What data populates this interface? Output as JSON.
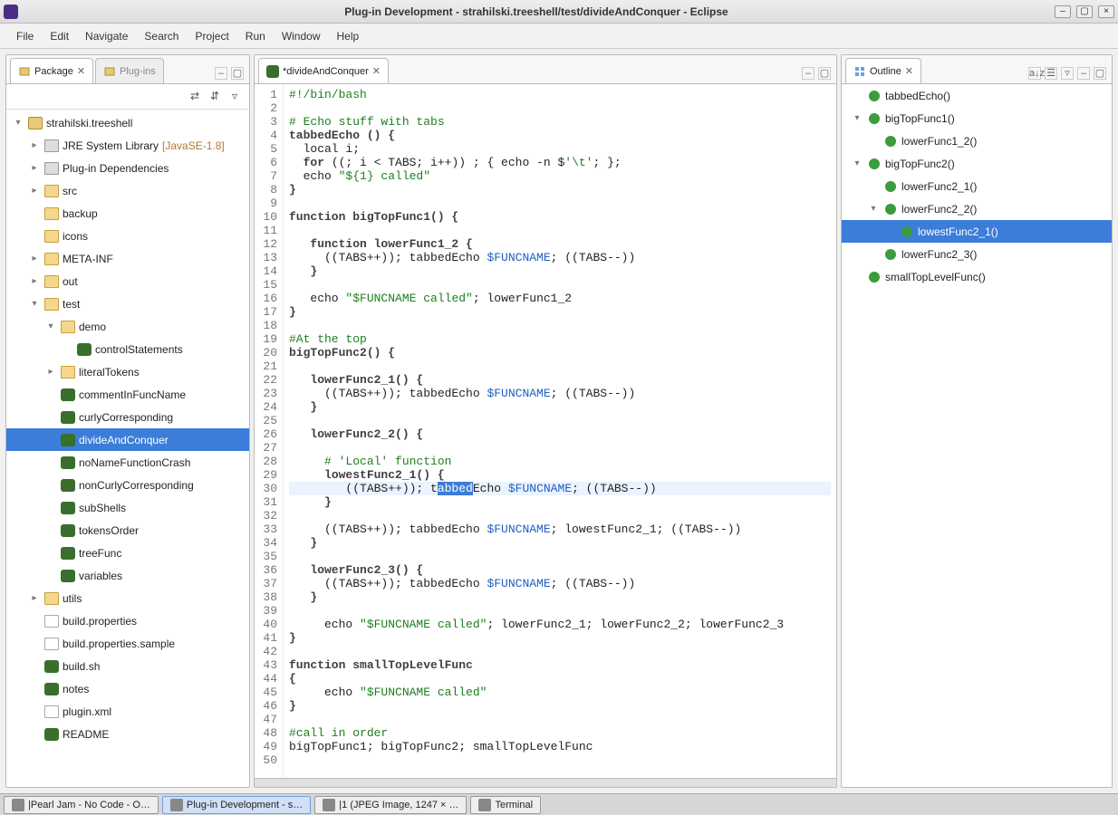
{
  "window": {
    "title": "Plug-in Development - strahilski.treeshell/test/divideAndConquer - Eclipse"
  },
  "menu": [
    "File",
    "Edit",
    "Navigate",
    "Search",
    "Project",
    "Run",
    "Window",
    "Help"
  ],
  "left": {
    "tabs": [
      {
        "label": "Package",
        "active": true,
        "close": true
      },
      {
        "label": "Plug-ins",
        "active": false,
        "close": false
      }
    ],
    "tree": [
      {
        "d": 0,
        "tw": "exp",
        "ic": "proj",
        "label": "strahilski.treeshell"
      },
      {
        "d": 1,
        "tw": "col",
        "ic": "lib",
        "label": "JRE System Library",
        "extra": " [JavaSE-1.8]"
      },
      {
        "d": 1,
        "tw": "col",
        "ic": "lib",
        "label": "Plug-in Dependencies"
      },
      {
        "d": 1,
        "tw": "col",
        "ic": "fold",
        "label": "src"
      },
      {
        "d": 1,
        "tw": "",
        "ic": "fold",
        "label": "backup"
      },
      {
        "d": 1,
        "tw": "",
        "ic": "fold",
        "label": "icons"
      },
      {
        "d": 1,
        "tw": "col",
        "ic": "fold",
        "label": "META-INF"
      },
      {
        "d": 1,
        "tw": "col",
        "ic": "fold",
        "label": "out"
      },
      {
        "d": 1,
        "tw": "exp",
        "ic": "fold",
        "label": "test"
      },
      {
        "d": 2,
        "tw": "exp",
        "ic": "fold",
        "label": "demo"
      },
      {
        "d": 3,
        "tw": "",
        "ic": "sh",
        "label": "controlStatements"
      },
      {
        "d": 2,
        "tw": "col",
        "ic": "fold",
        "label": "literalTokens"
      },
      {
        "d": 2,
        "tw": "",
        "ic": "sh",
        "label": "commentInFuncName"
      },
      {
        "d": 2,
        "tw": "",
        "ic": "sh",
        "label": "curlyCorresponding"
      },
      {
        "d": 2,
        "tw": "",
        "ic": "sh",
        "label": "divideAndConquer",
        "sel": true
      },
      {
        "d": 2,
        "tw": "",
        "ic": "sh",
        "label": "noNameFunctionCrash"
      },
      {
        "d": 2,
        "tw": "",
        "ic": "sh",
        "label": "nonCurlyCorresponding"
      },
      {
        "d": 2,
        "tw": "",
        "ic": "sh",
        "label": "subShells"
      },
      {
        "d": 2,
        "tw": "",
        "ic": "sh",
        "label": "tokensOrder"
      },
      {
        "d": 2,
        "tw": "",
        "ic": "sh",
        "label": "treeFunc"
      },
      {
        "d": 2,
        "tw": "",
        "ic": "sh",
        "label": "variables"
      },
      {
        "d": 1,
        "tw": "col",
        "ic": "fold",
        "label": "utils"
      },
      {
        "d": 1,
        "tw": "",
        "ic": "file",
        "label": "build.properties"
      },
      {
        "d": 1,
        "tw": "",
        "ic": "file",
        "label": "build.properties.sample"
      },
      {
        "d": 1,
        "tw": "",
        "ic": "sh",
        "label": "build.sh"
      },
      {
        "d": 1,
        "tw": "",
        "ic": "sh",
        "label": "notes"
      },
      {
        "d": 1,
        "tw": "",
        "ic": "file",
        "label": "plugin.xml"
      },
      {
        "d": 1,
        "tw": "",
        "ic": "sh",
        "label": "README"
      }
    ]
  },
  "editor": {
    "tabLabel": "*divideAndConquer",
    "lines": [
      {
        "n": 1,
        "segs": [
          {
            "t": "#!/bin/bash",
            "c": "cm"
          }
        ]
      },
      {
        "n": 2,
        "segs": []
      },
      {
        "n": 3,
        "segs": [
          {
            "t": "# Echo stuff with tabs",
            "c": "cm"
          }
        ]
      },
      {
        "n": 4,
        "segs": [
          {
            "t": "tabbedEcho () {",
            "c": "kw"
          }
        ]
      },
      {
        "n": 5,
        "segs": [
          {
            "t": "  local i;"
          }
        ]
      },
      {
        "n": 6,
        "segs": [
          {
            "t": "  "
          },
          {
            "t": "for",
            "c": "kw"
          },
          {
            "t": " ((; i < TABS; i++)) ; { echo -n $"
          },
          {
            "t": "'\\t'",
            "c": "str"
          },
          {
            "t": "; };"
          }
        ]
      },
      {
        "n": 7,
        "segs": [
          {
            "t": "  echo "
          },
          {
            "t": "\"${1} called\"",
            "c": "str"
          }
        ]
      },
      {
        "n": 8,
        "segs": [
          {
            "t": "}",
            "c": "kw"
          }
        ]
      },
      {
        "n": 9,
        "segs": []
      },
      {
        "n": 10,
        "segs": [
          {
            "t": "function bigTopFunc1() {",
            "c": "kw"
          }
        ]
      },
      {
        "n": 11,
        "segs": []
      },
      {
        "n": 12,
        "segs": [
          {
            "t": "   "
          },
          {
            "t": "function lowerFunc1_2 {",
            "c": "kw"
          }
        ]
      },
      {
        "n": 13,
        "segs": [
          {
            "t": "     ((TABS++)); tabbedEcho "
          },
          {
            "t": "$FUNCNAME",
            "c": "var"
          },
          {
            "t": "; ((TABS--))"
          }
        ]
      },
      {
        "n": 14,
        "segs": [
          {
            "t": "   "
          },
          {
            "t": "}",
            "c": "kw"
          }
        ]
      },
      {
        "n": 15,
        "segs": []
      },
      {
        "n": 16,
        "segs": [
          {
            "t": "   echo "
          },
          {
            "t": "\"$FUNCNAME called\"",
            "c": "str"
          },
          {
            "t": "; lowerFunc1_2"
          }
        ]
      },
      {
        "n": 17,
        "segs": [
          {
            "t": "}",
            "c": "kw"
          }
        ]
      },
      {
        "n": 18,
        "segs": []
      },
      {
        "n": 19,
        "segs": [
          {
            "t": "#At the top",
            "c": "cm"
          }
        ]
      },
      {
        "n": 20,
        "segs": [
          {
            "t": "bigTopFunc2() {",
            "c": "kw"
          }
        ]
      },
      {
        "n": 21,
        "segs": []
      },
      {
        "n": 22,
        "segs": [
          {
            "t": "   "
          },
          {
            "t": "lowerFunc2_1() {",
            "c": "kw"
          }
        ]
      },
      {
        "n": 23,
        "segs": [
          {
            "t": "     ((TABS++)); tabbedEcho "
          },
          {
            "t": "$FUNCNAME",
            "c": "var"
          },
          {
            "t": "; ((TABS--))"
          }
        ]
      },
      {
        "n": 24,
        "segs": [
          {
            "t": "   "
          },
          {
            "t": "}",
            "c": "kw"
          }
        ]
      },
      {
        "n": 25,
        "segs": []
      },
      {
        "n": 26,
        "segs": [
          {
            "t": "   "
          },
          {
            "t": "lowerFunc2_2() {",
            "c": "kw"
          }
        ]
      },
      {
        "n": 27,
        "segs": []
      },
      {
        "n": 28,
        "segs": [
          {
            "t": "     "
          },
          {
            "t": "# 'Local' function",
            "c": "cm"
          }
        ]
      },
      {
        "n": 29,
        "segs": [
          {
            "t": "     "
          },
          {
            "t": "lowestFunc2_1() {",
            "c": "kw"
          }
        ]
      },
      {
        "n": 30,
        "selrow": true,
        "segs": [
          {
            "t": "        ((TABS++)); t"
          },
          {
            "t": "abbed",
            "c": "selpart"
          },
          {
            "t": "Echo "
          },
          {
            "t": "$FUNCNAME",
            "c": "var"
          },
          {
            "t": "; ((TABS--))"
          }
        ]
      },
      {
        "n": 31,
        "segs": [
          {
            "t": "     "
          },
          {
            "t": "}",
            "c": "kw"
          }
        ]
      },
      {
        "n": 32,
        "segs": []
      },
      {
        "n": 33,
        "segs": [
          {
            "t": "     ((TABS++)); tabbedEcho "
          },
          {
            "t": "$FUNCNAME",
            "c": "var"
          },
          {
            "t": "; lowestFunc2_1; ((TABS--))"
          }
        ]
      },
      {
        "n": 34,
        "segs": [
          {
            "t": "   "
          },
          {
            "t": "}",
            "c": "kw"
          }
        ]
      },
      {
        "n": 35,
        "segs": []
      },
      {
        "n": 36,
        "segs": [
          {
            "t": "   "
          },
          {
            "t": "lowerFunc2_3() {",
            "c": "kw"
          }
        ]
      },
      {
        "n": 37,
        "segs": [
          {
            "t": "     ((TABS++)); tabbedEcho "
          },
          {
            "t": "$FUNCNAME",
            "c": "var"
          },
          {
            "t": "; ((TABS--))"
          }
        ]
      },
      {
        "n": 38,
        "segs": [
          {
            "t": "   "
          },
          {
            "t": "}",
            "c": "kw"
          }
        ]
      },
      {
        "n": 39,
        "segs": []
      },
      {
        "n": 40,
        "segs": [
          {
            "t": "     echo "
          },
          {
            "t": "\"$FUNCNAME called\"",
            "c": "str"
          },
          {
            "t": "; lowerFunc2_1; lowerFunc2_2; lowerFunc2_3"
          }
        ]
      },
      {
        "n": 41,
        "segs": [
          {
            "t": "}",
            "c": "kw"
          }
        ]
      },
      {
        "n": 42,
        "segs": []
      },
      {
        "n": 43,
        "segs": [
          {
            "t": "function smallTopLevelFunc",
            "c": "kw"
          }
        ]
      },
      {
        "n": 44,
        "segs": [
          {
            "t": "{",
            "c": "kw"
          }
        ]
      },
      {
        "n": 45,
        "segs": [
          {
            "t": "     echo "
          },
          {
            "t": "\"$FUNCNAME called\"",
            "c": "str"
          }
        ]
      },
      {
        "n": 46,
        "segs": [
          {
            "t": "}",
            "c": "kw"
          }
        ]
      },
      {
        "n": 47,
        "segs": []
      },
      {
        "n": 48,
        "segs": [
          {
            "t": "#call in order",
            "c": "cm"
          }
        ]
      },
      {
        "n": 49,
        "segs": [
          {
            "t": "bigTopFunc1; bigTopFunc2; smallTopLevelFunc"
          }
        ]
      },
      {
        "n": 50,
        "segs": []
      }
    ]
  },
  "outline": {
    "title": "Outline",
    "items": [
      {
        "d": 0,
        "tw": "",
        "label": "tabbedEcho()"
      },
      {
        "d": 0,
        "tw": "exp",
        "label": "bigTopFunc1()"
      },
      {
        "d": 1,
        "tw": "",
        "label": "lowerFunc1_2()"
      },
      {
        "d": 0,
        "tw": "exp",
        "label": "bigTopFunc2()"
      },
      {
        "d": 1,
        "tw": "",
        "label": "lowerFunc2_1()"
      },
      {
        "d": 1,
        "tw": "exp",
        "label": "lowerFunc2_2()"
      },
      {
        "d": 2,
        "tw": "",
        "label": "lowestFunc2_1()",
        "sel": true
      },
      {
        "d": 1,
        "tw": "",
        "label": "lowerFunc2_3()"
      },
      {
        "d": 0,
        "tw": "",
        "label": "smallTopLevelFunc()"
      }
    ]
  },
  "taskbar": [
    {
      "label": "|Pearl Jam - No Code - O…"
    },
    {
      "label": "Plug-in Development - s…",
      "active": true
    },
    {
      "label": "|1 (JPEG Image, 1247 × …"
    },
    {
      "label": "Terminal"
    }
  ]
}
